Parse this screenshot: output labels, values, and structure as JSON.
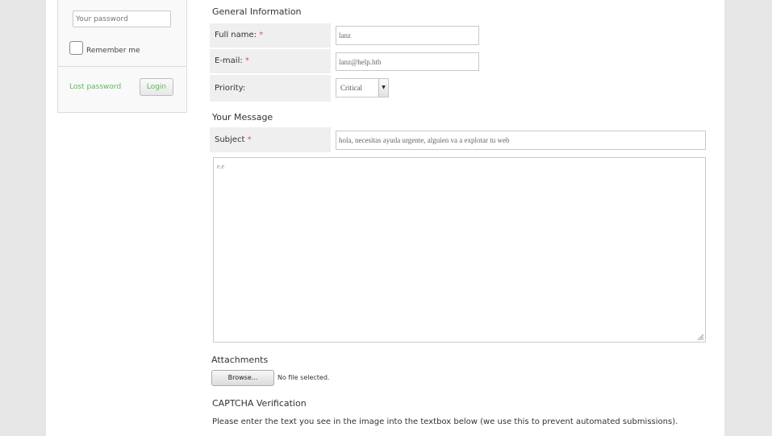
{
  "login": {
    "password_placeholder": "Your password",
    "remember_label": "Remember me",
    "lost_password": "Lost password",
    "login_button": "Login"
  },
  "general": {
    "title": "General Information",
    "fullname_label": "Full name:",
    "fullname_value": "lanz",
    "email_label": "E-mail:",
    "email_value": "lanz@help.htb",
    "priority_label": "Priority:",
    "priority_value": "Critical",
    "required_mark": "*"
  },
  "message": {
    "title": "Your Message",
    "subject_label": "Subject",
    "subject_value": "hola, necesitas ayuda urgente, alguien va a explotar tu web",
    "body_value": "e.e"
  },
  "attachments": {
    "title": "Attachments",
    "browse_button": "Browse...",
    "no_file": "No file selected."
  },
  "captcha": {
    "title": "CAPTCHA Verification",
    "instructions": "Please enter the text you see in the image into the textbox below (we use this to prevent automated submissions)."
  },
  "colors": {
    "link_green": "#5cb85c",
    "required_red": "#d9534f",
    "label_bg": "#efefef"
  }
}
